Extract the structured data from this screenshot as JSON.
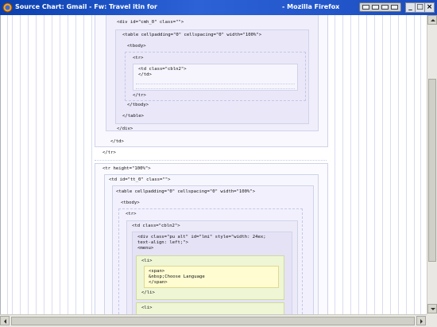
{
  "window": {
    "title": "Source Chart: Gmail - Fw: Travel itin for",
    "app_name": "- Mozilla Firefox",
    "minimize_label": "_",
    "maximize_label": "□",
    "close_label": "×"
  },
  "code": {
    "div_cmh": "<div id=\"cmh_0\" class=\"\">",
    "table1": "<table cellpadding=\"0\" cellspacing=\"0\" width=\"100%\">",
    "tbody1": "<tbody>",
    "tr1": "<tr>",
    "td_cbln2_a": "<td class=\"cbln2\">\n</td>",
    "tr1_close": "</tr>",
    "tbody1_close": "</tbody>",
    "table1_close": "</table>",
    "div_close": "</div>",
    "td_close": "</td>",
    "tr_close": "</tr>",
    "tr_height": "<tr height=\"100%\">",
    "td_tt": "<td id=\"tt_0\" class=\"\">",
    "table2": "<table cellpadding=\"0\" cellspacing=\"0\" width=\"100%\">",
    "tbody2": "<tbody>",
    "tr2": "<tr>",
    "td_cbln2_b": "<td class=\"cbln2\">",
    "div_pu": "<div class=\"pu alt\" id=\"lmi\" style=\"width: 24ex;\ntext-align: left;\">\n<menu>",
    "li1": "<li>",
    "span_block": "<span>\n&nbsp;Choose Language\n</span>",
    "li1_close": "</li>",
    "li2": "<li>"
  },
  "colors": {
    "titlebar": "#1a4cbf",
    "lavender_box": "#eceaf8",
    "green_box": "#eef6d6",
    "yellow_box": "#fffcd2"
  }
}
